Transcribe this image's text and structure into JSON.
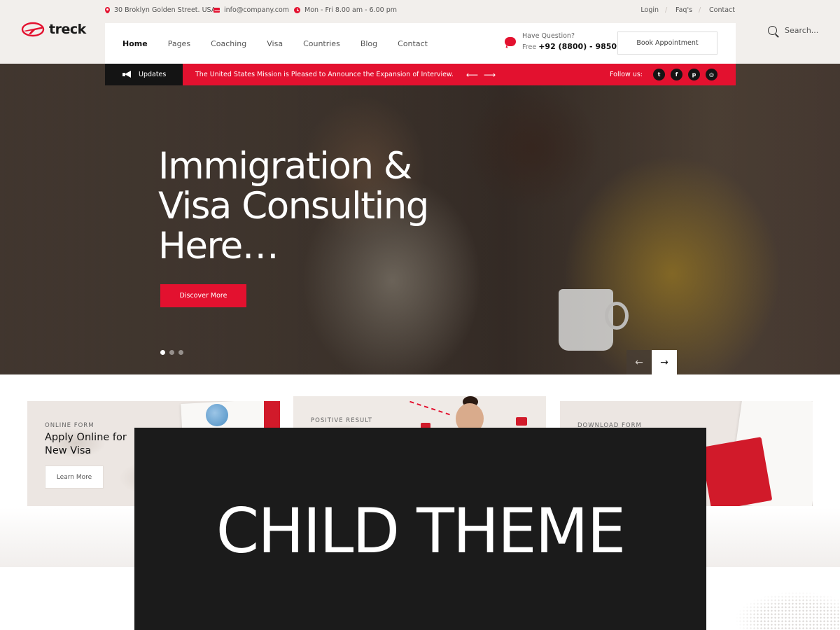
{
  "brand": {
    "name": "treck",
    "accent": "#e3112f",
    "dark": "#141414"
  },
  "topbar": {
    "address": "30 Broklyn Golden Street. USA",
    "email": "info@company.com",
    "hours": "Mon - Fri 8.00 am - 6.00 pm",
    "links": [
      "Login",
      "Faq's",
      "Contact"
    ]
  },
  "nav": {
    "items": [
      "Home",
      "Pages",
      "Coaching",
      "Visa",
      "Countries",
      "Blog",
      "Contact"
    ],
    "active": "Home"
  },
  "question": {
    "title": "Have Question?",
    "free_label": "Free",
    "phone": "+92 (8800) - 9850"
  },
  "book_button": "Book Appointment",
  "search": {
    "placeholder": "Search..."
  },
  "updates": {
    "label": "Updates",
    "text": "The United States Mission is Pleased to Announce the Expansion of Interview.",
    "prev_arrow": "⟵",
    "next_arrow": "⟶",
    "follow_label": "Follow us:",
    "socials": [
      "twitter-icon",
      "facebook-icon",
      "pinterest-icon",
      "instagram-icon"
    ]
  },
  "hero": {
    "title_lines": [
      "Immigration &",
      "Visa Consulting",
      "Here…"
    ],
    "button": "Discover More",
    "slides": 3,
    "active_slide": 1,
    "prev_arrow": "←",
    "next_arrow": "→"
  },
  "cards": [
    {
      "kicker": "ONLINE FORM",
      "title": "Apply Online for New Visa",
      "button": "Learn More"
    },
    {
      "kicker": "POSITIVE RESULT"
    },
    {
      "kicker": "DOWNLOAD FORM"
    }
  ],
  "overlay": {
    "text": "CHILD THEME"
  }
}
